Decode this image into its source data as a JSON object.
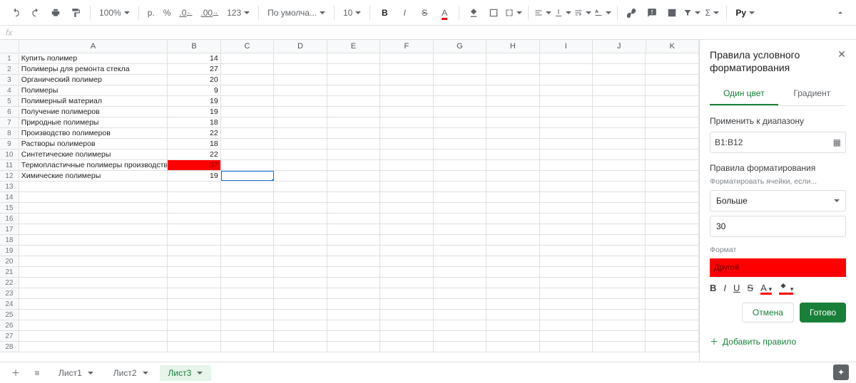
{
  "toolbar": {
    "zoom": "100%",
    "currency_symbol": "p.",
    "percent": "%",
    "dec_decrease": ".0",
    "dec_increase": ".00",
    "more_formats": "123",
    "font": "По умолча...",
    "font_size": "10",
    "bold": "B",
    "italic": "I",
    "strike": "S",
    "text_color": "A",
    "ru_toggle": "Pу"
  },
  "fx": {
    "label": "fx"
  },
  "columns": [
    "A",
    "B",
    "C",
    "D",
    "E",
    "F",
    "G",
    "H",
    "I",
    "J",
    "K"
  ],
  "spreadsheet": {
    "rows": [
      {
        "a": "Купить полимер",
        "b": "14"
      },
      {
        "a": "Полимеры для ремонта стекла",
        "b": "27"
      },
      {
        "a": "Органический полимер",
        "b": "20"
      },
      {
        "a": "Полимеры",
        "b": "9"
      },
      {
        "a": "Полимерный материал",
        "b": "19"
      },
      {
        "a": "Получение полимеров",
        "b": "19"
      },
      {
        "a": "Природные полимеры",
        "b": "18"
      },
      {
        "a": "Производство полимеров",
        "b": "22"
      },
      {
        "a": "Растворы полимеров",
        "b": "18"
      },
      {
        "a": "Синтетические полимеры",
        "b": "22"
      },
      {
        "a": "Термопластичные полимеры производство",
        "b": "37",
        "bRed": true
      },
      {
        "a": "Химические полимеры",
        "b": "19"
      }
    ],
    "totalRows": 28,
    "selected": {
      "row_index": 11,
      "col": "C"
    }
  },
  "sidebar": {
    "title": "Правила условного форматирования",
    "tabs": {
      "single": "Один цвет",
      "gradient": "Градиент"
    },
    "apply_range_label": "Применить к диапазону",
    "range": "B1:B12",
    "rules_label": "Правила форматирования",
    "format_if_label": "Форматировать ячейки, если...",
    "condition": "Больше",
    "value": "30",
    "format_label": "Формат",
    "format_preview": "Другой",
    "fmt_buttons": {
      "bold": "B",
      "italic": "I",
      "underline": "U",
      "strike": "S",
      "text_color": "A"
    },
    "cancel": "Отмена",
    "done": "Готово",
    "add_rule": "Добавить правило"
  },
  "footer": {
    "sheets": [
      "Лист1",
      "Лист2",
      "Лист3"
    ],
    "active_index": 2
  }
}
